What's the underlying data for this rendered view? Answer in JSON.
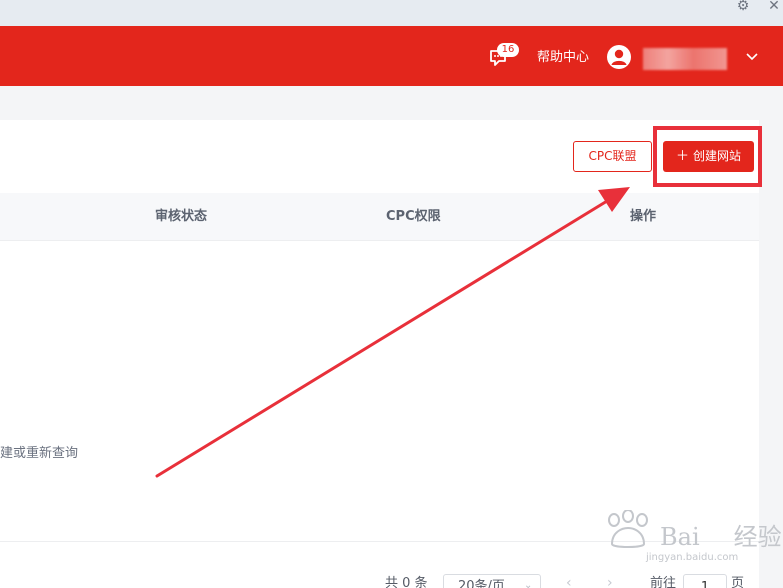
{
  "header": {
    "message_badge": "16",
    "help_label": "帮助中心"
  },
  "toolbar": {
    "cpc_alliance_label": "CPC联盟",
    "create_site_label": "创建网站",
    "create_site_icon": "plus-icon"
  },
  "table": {
    "columns": [
      "审核状态",
      "CPC权限",
      "操作"
    ],
    "empty_text": "建或重新查询"
  },
  "pagination": {
    "total_text": "共 0 条",
    "page_size": "20条/页",
    "goto_label": "前往",
    "current_page": "1",
    "page_unit": "页"
  },
  "watermark": {
    "logo_text": "Bai",
    "logo_text_2": "经验",
    "url": "jingyan.baidu.com"
  },
  "colors": {
    "brand": "#e3261c",
    "annotation": "#e8303a"
  }
}
